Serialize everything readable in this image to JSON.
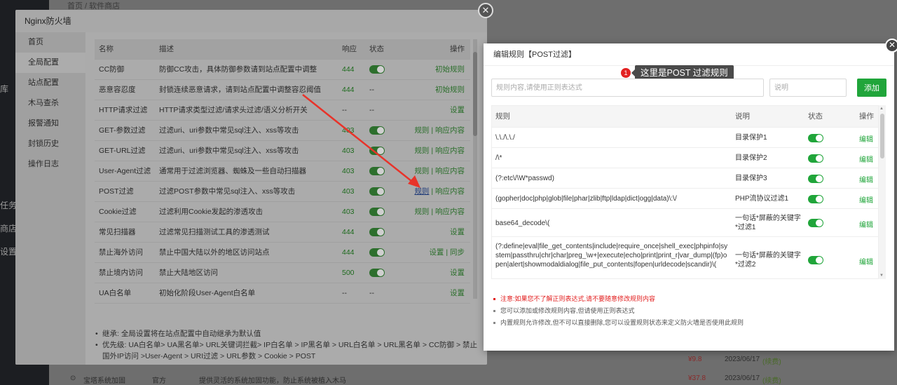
{
  "background": {
    "breadcrumb": "首页 / 软件商店",
    "sidebar_fragments": [
      "库",
      "任务",
      "商店",
      "设置"
    ],
    "rows": [
      {
        "price": "¥9.8",
        "date": "2023/06/17",
        "renew": "(续费)"
      },
      {
        "icon": "⊙",
        "name": "宝塔系统加固",
        "vendor": "官方",
        "desc": "提供灵活的系统加固功能，防止系统被植入木马",
        "price": "¥37.8",
        "date": "2023/06/17",
        "renew": "(续费)"
      }
    ]
  },
  "firewall": {
    "title": "Nginx防火墙",
    "tabs": [
      {
        "label": "首页"
      },
      {
        "label": "全局配置"
      },
      {
        "label": "站点配置"
      },
      {
        "label": "木马查杀"
      },
      {
        "label": "报警通知"
      },
      {
        "label": "封锁历史"
      },
      {
        "label": "操作日志"
      }
    ],
    "columns": {
      "name": "名称",
      "desc": "描述",
      "code": "响应",
      "status": "状态",
      "op": "操作"
    },
    "rows": [
      {
        "name": "CC防御",
        "desc": "防御CC攻击，具体防御参数请到站点配置中调整",
        "code": "444",
        "status": "toggle",
        "op": "初始规则"
      },
      {
        "name": "恶意容忍度",
        "desc": "封锁连续恶意请求，请到站点配置中调整容忍阈值",
        "code": "444",
        "status": "--",
        "op": "初始规则"
      },
      {
        "name": "HTTP请求过滤",
        "desc": "HTTP请求类型过滤/请求头过滤/语义分析开关",
        "code": "--",
        "status": "--",
        "op": "设置"
      },
      {
        "name": "GET-参数过滤",
        "desc": "过滤uri、uri参数中常见sql注入、xss等攻击",
        "code": "403",
        "status": "toggle",
        "op": "规则 | 响应内容"
      },
      {
        "name": "GET-URL过滤",
        "desc": "过滤uri、uri参数中常见sql注入、xss等攻击",
        "code": "403",
        "status": "toggle",
        "op": "规则 | 响应内容"
      },
      {
        "name": "User-Agent过滤",
        "desc": "通常用于过滤浏览器、蜘蛛及一些自动扫描器",
        "code": "403",
        "status": "toggle",
        "op": "规则 | 响应内容"
      },
      {
        "name": "POST过滤",
        "desc": "过滤POST参数中常见sql注入、xss等攻击",
        "code": "403",
        "status": "toggle",
        "op": "规则 | 响应内容"
      },
      {
        "name": "Cookie过滤",
        "desc": "过滤利用Cookie发起的渗透攻击",
        "code": "403",
        "status": "toggle",
        "op": "规则 | 响应内容"
      },
      {
        "name": "常见扫描器",
        "desc": "过滤常见扫描测试工具的渗透测试",
        "code": "444",
        "status": "toggle",
        "op": "设置"
      },
      {
        "name": "禁止海外访问",
        "desc": "禁止中国大陆以外的地区访问站点",
        "code": "444",
        "status": "toggle",
        "op": "设置 | 同步"
      },
      {
        "name": "禁止境内访问",
        "desc": "禁止大陆地区访问",
        "code": "500",
        "status": "toggle",
        "op": "设置"
      },
      {
        "name": "UA白名单",
        "desc": "初始化阶段User-Agent白名单",
        "code": "--",
        "status": "--",
        "op": "设置"
      }
    ],
    "notes": [
      "继承: 全局设置将在站点配置中自动继承为默认值",
      "优先级: UA白名单> UA黑名单> URL关键词拦截> IP白名单 > IP黑名单 > URL白名单 > URL黑名单 > CC防御 > 禁止国外IP访问 >User-Agent > URI过滤 > URL参数 > Cookie > POST"
    ]
  },
  "edit_rule": {
    "title": "编辑规则【POST过滤】",
    "tip_badge": "1",
    "tip_text": "这里是POST 过滤规则",
    "rule_placeholder": "规则内容,请使用正则表达式",
    "desc_placeholder": "说明",
    "add_label": "添加",
    "columns": {
      "rule": "规则",
      "desc": "说明",
      "status": "状态",
      "op": "操作"
    },
    "rows": [
      {
        "rule": "\\.\\./\\.\\./",
        "desc": "目录保护1",
        "op": "编辑"
      },
      {
        "rule": "/\\*",
        "desc": "目录保护2",
        "op": "编辑"
      },
      {
        "rule": "(?:etc\\/\\W*passwd)",
        "desc": "目录保护3",
        "op": "编辑"
      },
      {
        "rule": "(gopher|doc|php|glob|file|phar|zlib|ftp|ldap|dict|ogg|data)\\:\\/",
        "desc": "PHP流协议过滤1",
        "op": "编辑"
      },
      {
        "rule": "base64_decode\\(",
        "desc": "一句话*屏蔽的关键字*过滤1",
        "op": "编辑"
      },
      {
        "rule": "(?:define|eval|file_get_contents|include|require_once|shell_exec|phpinfo|system|passthru|chr|char|preg_\\w+|execute|echo|print|print_r|var_dump|(fp)open|alert|showmodaldialog|file_put_contents|fopen|urldecode|scandir)\\(",
        "desc": "一句话*屏蔽的关键字*过滤2",
        "op": "编辑"
      }
    ],
    "notes": [
      "注意:如果您不了解正则表达式,请不要随意修改规则内容",
      "您可以添加或修改规则内容,但请使用正则表达式",
      "内置规则允许修改,但不可以直接删除,您可以设置规则状态来定义防火墙是否使用此规则"
    ]
  }
}
